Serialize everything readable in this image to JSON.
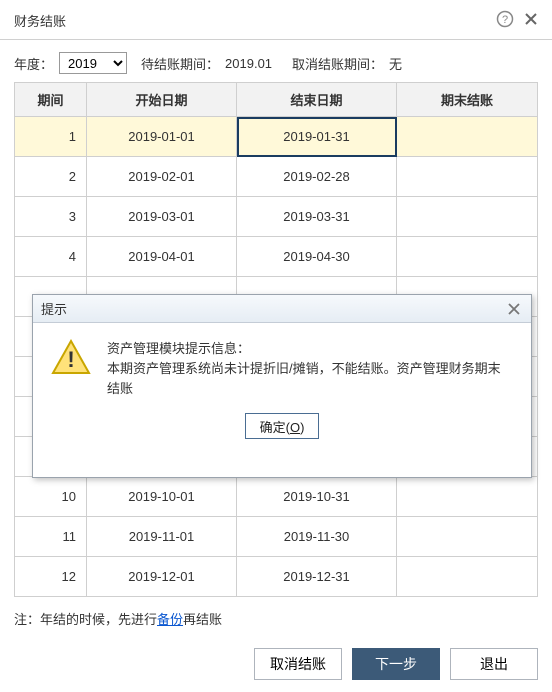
{
  "dialog_title": "财务结账",
  "header_icons": {
    "help": "help-icon",
    "close": "close-icon"
  },
  "filter": {
    "year_label": "年度：",
    "year_value": "2019",
    "pending_label": "待结账期间：",
    "pending_value": "2019.01",
    "cancel_label": "取消结账期间：",
    "cancel_value": "无"
  },
  "columns": {
    "period": "期间",
    "start": "开始日期",
    "end": "结束日期",
    "closed": "期末结账"
  },
  "rows": [
    {
      "period": "1",
      "start": "2019-01-01",
      "end": "2019-01-31",
      "closed": "",
      "highlight": true,
      "selected_col": "end"
    },
    {
      "period": "2",
      "start": "2019-02-01",
      "end": "2019-02-28",
      "closed": ""
    },
    {
      "period": "3",
      "start": "2019-03-01",
      "end": "2019-03-31",
      "closed": ""
    },
    {
      "period": "4",
      "start": "2019-04-01",
      "end": "2019-04-30",
      "closed": ""
    },
    {
      "period": "",
      "start": "",
      "end": "",
      "closed": ""
    },
    {
      "period": "",
      "start": "",
      "end": "",
      "closed": ""
    },
    {
      "period": "",
      "start": "",
      "end": "",
      "closed": ""
    },
    {
      "period": "",
      "start": "",
      "end": "",
      "closed": ""
    },
    {
      "period": "",
      "start": "",
      "end": "",
      "closed": ""
    },
    {
      "period": "10",
      "start": "2019-10-01",
      "end": "2019-10-31",
      "closed": ""
    },
    {
      "period": "11",
      "start": "2019-11-01",
      "end": "2019-11-30",
      "closed": ""
    },
    {
      "period": "12",
      "start": "2019-12-01",
      "end": "2019-12-31",
      "closed": ""
    }
  ],
  "note": {
    "prefix": "注：年结的时候，先进行",
    "link": "备份",
    "suffix": "再结账"
  },
  "buttons": {
    "cancel_close": "取消结账",
    "next": "下一步",
    "exit": "退出"
  },
  "alert": {
    "title": "提示",
    "line1": "资产管理模块提示信息：",
    "line2": "本期资产管理系统尚未计提折旧/摊销，不能结账。资产管理财务期末结账",
    "ok_label": "确定",
    "ok_key": "O"
  }
}
